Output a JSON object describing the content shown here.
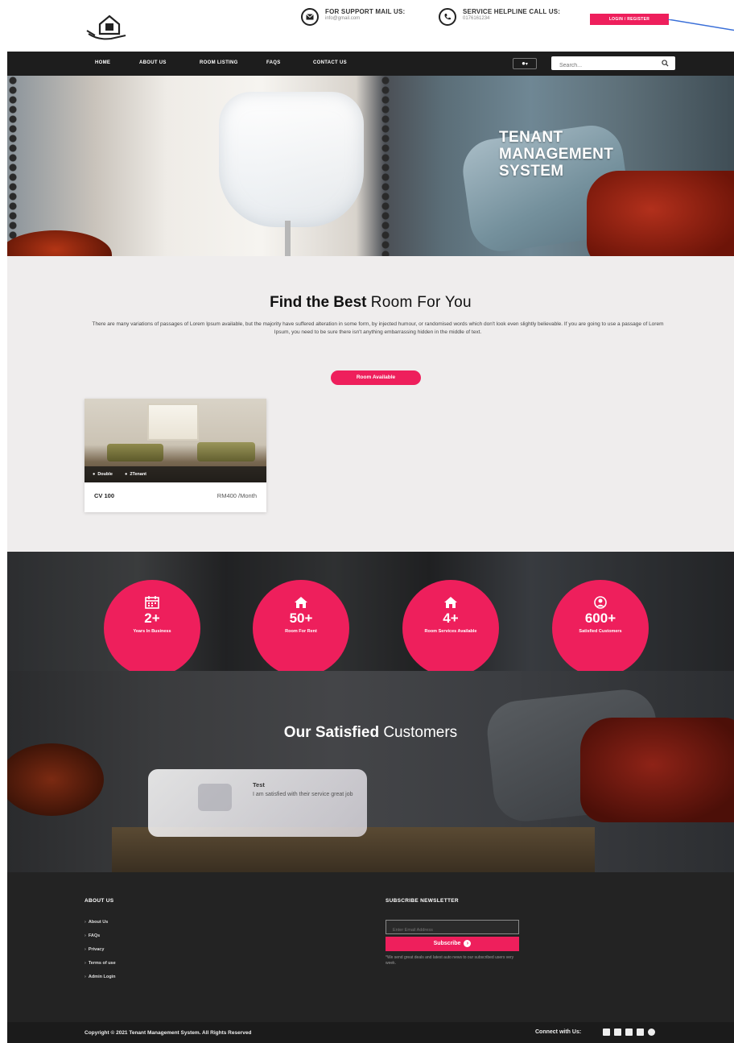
{
  "header": {
    "mail": {
      "title": "FOR SUPPORT MAIL US:",
      "value": "info@gmail.com"
    },
    "phone": {
      "title": "SERVICE HELPLINE CALL US:",
      "value": "0176161234"
    },
    "login_label": "LOGIN / REGISTER"
  },
  "nav": {
    "items": [
      "HOME",
      "ABOUT US",
      "ROOM LISTING",
      "FAQS",
      "CONTACT US"
    ],
    "lang_icon": "globe-icon",
    "search_placeholder": "Search..."
  },
  "hero": {
    "title": "TENANT MANAGEMENT SYSTEM"
  },
  "rooms": {
    "title_bold": "Find the Best",
    "title_light": "Room For You",
    "description": "There are many variations of passages of Lorem Ipsum available, but the majority have suffered alteration in some form, by injected humour, or randomised words which don't look even slightly believable. If you are going to use a passage of Lorem Ipsum, you need to be sure there isn't anything embarrassing hidden in the middle of text.",
    "button_label": "Room Available",
    "cards": [
      {
        "bed": "Double",
        "tenant": "2Tenant",
        "name": "CV 100",
        "price": "RM400 /Month"
      }
    ]
  },
  "stats": [
    {
      "icon": "calendar-icon",
      "value": "2+",
      "label": "Years In Business"
    },
    {
      "icon": "home-icon",
      "value": "50+",
      "label": "Room For Rent"
    },
    {
      "icon": "home-icon",
      "value": "4+",
      "label": "Room Services Available"
    },
    {
      "icon": "user-icon",
      "value": "600+",
      "label": "Satisfied Customers"
    }
  ],
  "testimonials": {
    "title_bold": "Our Satisfied",
    "title_light": "Customers",
    "items": [
      {
        "name": "Test",
        "text": "I am satisfied with their service great job"
      }
    ]
  },
  "footer": {
    "about_heading": "ABOUT US",
    "links": [
      "About Us",
      "FAQs",
      "Privacy",
      "Terms of use",
      "Admin Login"
    ],
    "newsletter_heading": "SUBSCRIBE NEWSLETTER",
    "email_placeholder": "Enter Email Address",
    "subscribe_label": "Subscribe",
    "note": "*We send great deals and latest auto news to our subscribed users very week."
  },
  "copyright": "Copyright © 2021 Tenant Management System. All Rights Reserved",
  "connect_label": "Connect with Us:",
  "social_icons": [
    "facebook-icon",
    "twitter-icon",
    "linkedin-icon",
    "google-plus-icon",
    "instagram-icon"
  ],
  "colors": {
    "accent": "#ee1f5c",
    "nav_bg": "#1d1d1d",
    "footer_bg": "#232323",
    "section_bg": "#efeded"
  }
}
